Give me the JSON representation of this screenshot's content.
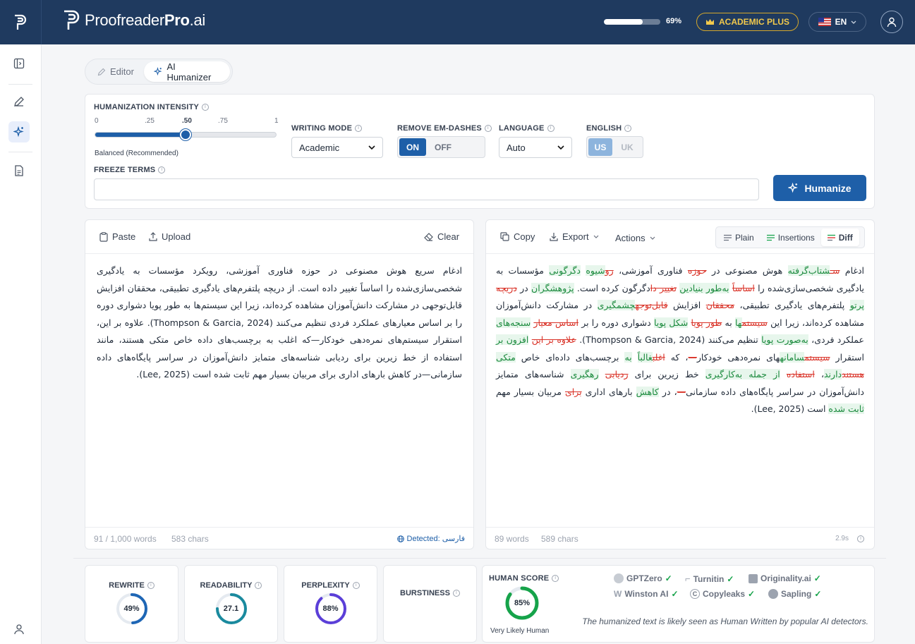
{
  "brand": {
    "name_regular": "Proofreader",
    "name_bold": "Pro",
    "name_suffix": ".ai"
  },
  "header": {
    "usage_percent": 69,
    "usage_label": "69%",
    "plan_label": "ACADEMIC PLUS",
    "language": "EN",
    "colors": {
      "bar": "#1f3a5f",
      "plan_accent": "#f2c94c",
      "primary": "#1e5fa8"
    }
  },
  "sidebar": {
    "items": [
      {
        "icon": "panel-toggle-icon"
      },
      {
        "icon": "pencil-icon"
      },
      {
        "icon": "sparkles-icon",
        "active": true
      },
      {
        "icon": "document-icon"
      }
    ],
    "bottom_icon": "user-icon"
  },
  "tabs": [
    {
      "label": "Editor",
      "icon": "pencil-icon"
    },
    {
      "label": "AI Humanizer",
      "icon": "sparkles-icon",
      "active": true
    }
  ],
  "settings": {
    "intensity": {
      "label": "HUMANIZATION INTENSITY",
      "ticks": [
        "0",
        ".25",
        ".50",
        ".75",
        "1"
      ],
      "value": 0.5,
      "caption": "Balanced (Recommended)"
    },
    "writing_mode": {
      "label": "WRITING MODE",
      "value": "Academic"
    },
    "em_dashes": {
      "label": "REMOVE EM-DASHES",
      "on": "ON",
      "off": "OFF",
      "selected": "ON"
    },
    "language": {
      "label": "LANGUAGE",
      "value": "Auto"
    },
    "english": {
      "label": "ENGLISH",
      "us": "US",
      "uk": "UK",
      "selected": "US"
    },
    "freeze": {
      "label": "FREEZE TERMS",
      "value": ""
    },
    "humanize_button": "Humanize"
  },
  "input_panel": {
    "paste": "Paste",
    "upload": "Upload",
    "clear": "Clear",
    "text": "ادغام سریع هوش مصنوعی در حوزه فناوری آموزشی، رویکرد مؤسسات به یادگیری شخصی‌سازی‌شده را اساساً تغییر داده است. از دریچه پلتفرم‌های یادگیری تطبیقی، محققان افزایش قابل‌توجهی در مشارکت دانش‌آموزان مشاهده کرده‌اند، زیرا این سیستم‌ها به طور پویا دشواری دوره را بر اساس معیارهای عملکرد فردی تنظیم می‌کنند (Thompson & Garcia, 2024). علاوه بر این، استقرار سیستم‌های نمره‌دهی خودکار—که اغلب به برچسب‌های داده خاص متکی هستند، مانند استفاده از خط زیرین برای ردیابی شناسه‌های متمایز دانش‌آموزان در سراسر پایگاه‌های داده سازمانی—در کاهش بارهای اداری برای مربیان بسیار مهم ثابت شده است (Lee, 2025).",
    "words": "91 / 1,000 words",
    "chars": "583 chars",
    "detected": "Detected: فارسی"
  },
  "output_panel": {
    "copy": "Copy",
    "export": "Export",
    "actions": "Actions",
    "views": [
      {
        "label": "Plain",
        "icon": "lines-icon"
      },
      {
        "label": "Insertions",
        "icon": "insertions-icon"
      },
      {
        "label": "Diff",
        "icon": "diff-icon",
        "active": true
      }
    ],
    "diff": [
      {
        "t": "ادغام ",
        "k": "n"
      },
      {
        "t": "سـ",
        "k": "d"
      },
      {
        "t": "شتاب‌گرفته",
        "k": "i"
      },
      {
        "t": " هوش مصنوعی در ",
        "k": "n"
      },
      {
        "t": "حوزه",
        "k": "d"
      },
      {
        "t": " فناوری آموزشی، ",
        "k": "n"
      },
      {
        "t": "رو",
        "k": "d"
      },
      {
        "t": "شیوه",
        "k": "i"
      },
      {
        "t": " ",
        "k": "n"
      },
      {
        "t": "دگرگونی",
        "k": "i"
      },
      {
        "t": " مؤسسات به یادگیری شخصی‌سازی‌شده را ",
        "k": "n"
      },
      {
        "t": "اساساً",
        "k": "d"
      },
      {
        "t": " ",
        "k": "n"
      },
      {
        "t": "به‌طور بنیادین",
        "k": "i"
      },
      {
        "t": " ",
        "k": "n"
      },
      {
        "t": "تغییر دا",
        "k": "d"
      },
      {
        "t": "دگرگون کرده است. ",
        "k": "n"
      },
      {
        "t": "پژوهشگران",
        "k": "i"
      },
      {
        "t": " در ",
        "k": "n"
      },
      {
        "t": "دریچه",
        "k": "d"
      },
      {
        "t": " ",
        "k": "n"
      },
      {
        "t": "پرتو",
        "k": "i"
      },
      {
        "t": " پلتفرم‌های یادگیری تطبیقی، ",
        "k": "n"
      },
      {
        "t": "محققان",
        "k": "d"
      },
      {
        "t": " افزایش ",
        "k": "n"
      },
      {
        "t": "قابل‌توجه",
        "k": "d"
      },
      {
        "t": "چشمگیری",
        "k": "i"
      },
      {
        "t": " در مشارکت دانش‌آموزان مشاهده کرده‌اند، زیرا این ",
        "k": "n"
      },
      {
        "t": "سیستم",
        "k": "d"
      },
      {
        "t": "ها",
        "k": "i"
      },
      {
        "t": " به ",
        "k": "n"
      },
      {
        "t": "طور پویا",
        "k": "d"
      },
      {
        "t": " ",
        "k": "n"
      },
      {
        "t": "شکل پویا",
        "k": "i"
      },
      {
        "t": " دشواری دوره را بر ",
        "k": "n"
      },
      {
        "t": "اساس معیار",
        "k": "d"
      },
      {
        "t": " ",
        "k": "n"
      },
      {
        "t": "سنجه‌های",
        "k": "i"
      },
      {
        "t": " عملکرد فردی، ",
        "k": "n"
      },
      {
        "t": "به‌صورت پویا",
        "k": "i"
      },
      {
        "t": " تنظیم می‌کنند (Thompson & Garcia, 2024). ",
        "k": "n"
      },
      {
        "t": "علاوه بر این",
        "k": "d"
      },
      {
        "t": " ",
        "k": "n"
      },
      {
        "t": "افزون بر",
        "k": "i"
      },
      {
        "t": " استقرار ",
        "k": "n"
      },
      {
        "t": "سیستم",
        "k": "d"
      },
      {
        "t": "سامانه",
        "k": "i"
      },
      {
        "t": "های نمره‌دهی خودکار",
        "k": "n"
      },
      {
        "t": "—",
        "k": "d"
      },
      {
        "t": "، که ",
        "k": "n"
      },
      {
        "t": "اغلب",
        "k": "d"
      },
      {
        "t": "غالباً",
        "k": "i"
      },
      {
        "t": " ",
        "k": "n"
      },
      {
        "t": "به",
        "k": "i"
      },
      {
        "t": " برچسب‌های داده‌ای خاص ",
        "k": "n"
      },
      {
        "t": "متکی",
        "k": "i"
      },
      {
        "t": " ",
        "k": "n"
      },
      {
        "t": "هستند",
        "k": "d"
      },
      {
        "t": "دارند",
        "k": "i"
      },
      {
        "t": "، ",
        "k": "n"
      },
      {
        "t": "استفاده",
        "k": "d"
      },
      {
        "t": " ",
        "k": "n"
      },
      {
        "t": "از جمله به‌کارگیری",
        "k": "i"
      },
      {
        "t": " خط زیرین برای ",
        "k": "n"
      },
      {
        "t": "ردیابی",
        "k": "d"
      },
      {
        "t": " ",
        "k": "n"
      },
      {
        "t": "رهگیری",
        "k": "i"
      },
      {
        "t": " شناسه‌های متمایز دانش‌آموزان در سراسر پایگاه‌های داده سازمانی",
        "k": "n"
      },
      {
        "t": "—",
        "k": "d"
      },
      {
        "t": "، در ",
        "k": "n"
      },
      {
        "t": "کاهش",
        "k": "i"
      },
      {
        "t": " بارهای اداری ",
        "k": "n"
      },
      {
        "t": "برای",
        "k": "d"
      },
      {
        "t": " مربیان بسیار مهم ",
        "k": "n"
      },
      {
        "t": "ثابت شده",
        "k": "i"
      },
      {
        "t": " است (Lee, 2025).",
        "k": "n"
      }
    ],
    "words": "89 words",
    "chars": "589 chars",
    "time": "2.9s"
  },
  "metrics": [
    {
      "label": "REWRITE",
      "display": "49%",
      "value": 0.49,
      "color": "#1e66b5"
    },
    {
      "label": "READABILITY",
      "display": "27.1",
      "value": 0.75,
      "color": "#1a8a9e"
    },
    {
      "label": "PERPLEXITY",
      "display": "88%",
      "value": 0.88,
      "color": "#5b3fd8"
    },
    {
      "label": "BURSTINESS",
      "display": "",
      "value": 0,
      "color": "#9ca3af"
    }
  ],
  "human_score": {
    "label": "HUMAN SCORE",
    "display": "85%",
    "value": 0.85,
    "caption": "Very Likely Human",
    "color": "#16a34a",
    "note": "The humanized text is likely seen as Human Written by popular AI detectors.",
    "detectors": [
      "GPTZero",
      "Turnitin",
      "Originality.ai",
      "Winston AI",
      "Copyleaks",
      "Sapling"
    ]
  }
}
